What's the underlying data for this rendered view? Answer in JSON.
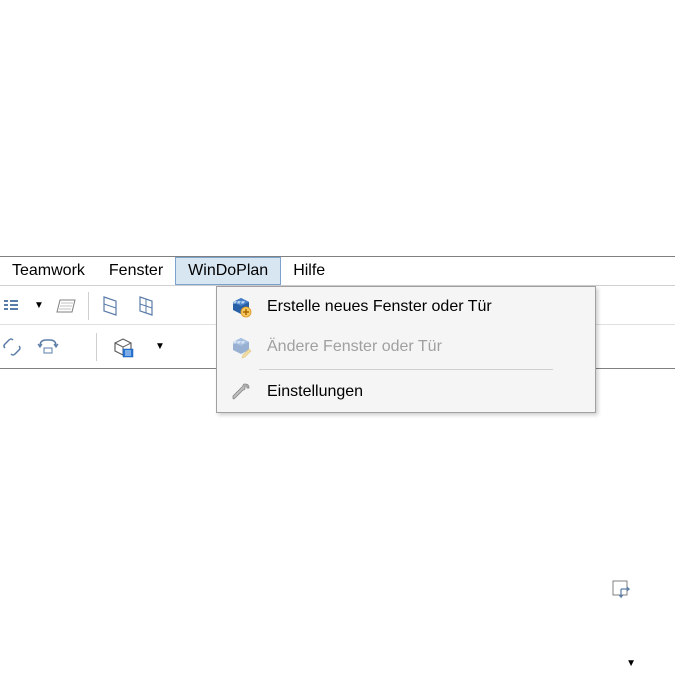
{
  "menubar": {
    "items": [
      {
        "label": "Teamwork",
        "active": false
      },
      {
        "label": "Fenster",
        "active": false
      },
      {
        "label": "WinDoPlan",
        "active": true
      },
      {
        "label": "Hilfe",
        "active": false
      }
    ]
  },
  "dropdown": {
    "items": [
      {
        "label": "Erstelle neues Fenster oder Tür",
        "icon": "window-add-icon",
        "disabled": false
      },
      {
        "label": "Ändere Fenster oder Tür",
        "icon": "window-edit-icon",
        "disabled": true
      },
      {
        "label": "Einstellungen",
        "icon": "wrench-icon",
        "disabled": false
      }
    ]
  },
  "colors": {
    "accent_blue": "#3a6fb7",
    "highlight_bg": "#d8e6f2",
    "highlight_border": "#7da2ce",
    "disabled_text": "#a0a0a0"
  }
}
